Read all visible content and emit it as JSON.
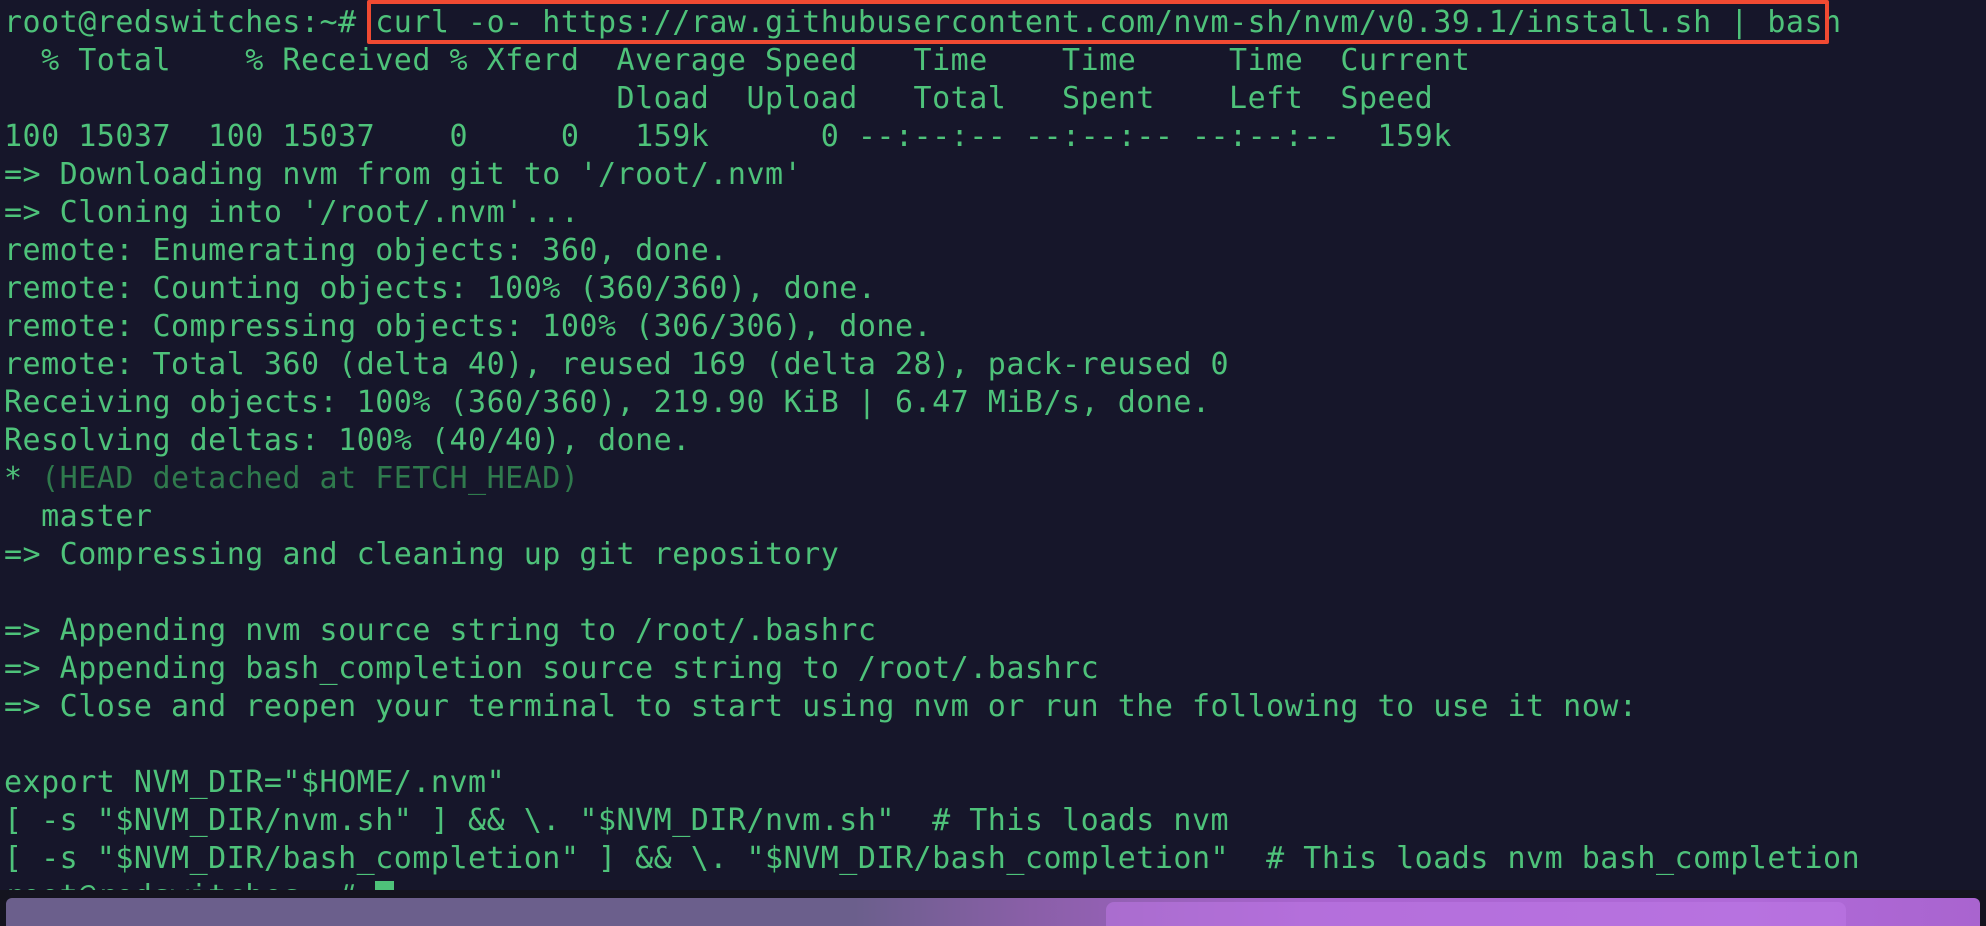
{
  "terminal": {
    "colors": {
      "background": "#16162a",
      "foreground": "#4ec27a",
      "dim_foreground": "#2f7a4d",
      "highlight_border": "#f04a32",
      "cursor": "#4ec27a",
      "taskbar_accent": "#a964cf"
    },
    "prompt": "root@redswitches:~#",
    "command": "curl -o- https://raw.githubusercontent.com/nvm-sh/nvm/v0.39.1/install.sh | bash",
    "lines": [
      {
        "id": "curl-header-1",
        "text": "  % Total    % Received % Xferd  Average Speed   Time    Time     Time  Current"
      },
      {
        "id": "curl-header-2",
        "text": "                                 Dload  Upload   Total   Spent    Left  Speed"
      },
      {
        "id": "curl-stats",
        "text": "100 15037  100 15037    0     0   159k      0 --:--:-- --:--:-- --:--:--  159k"
      },
      {
        "id": "downloading-nvm",
        "text": "=> Downloading nvm from git to '/root/.nvm'"
      },
      {
        "id": "cloning-into",
        "text": "=> Cloning into '/root/.nvm'..."
      },
      {
        "id": "remote-enumerating",
        "text": "remote: Enumerating objects: 360, done."
      },
      {
        "id": "remote-counting",
        "text": "remote: Counting objects: 100% (360/360), done."
      },
      {
        "id": "remote-compressing",
        "text": "remote: Compressing objects: 100% (306/306), done."
      },
      {
        "id": "remote-total",
        "text": "remote: Total 360 (delta 40), reused 169 (delta 28), pack-reused 0"
      },
      {
        "id": "receiving-objects",
        "text": "Receiving objects: 100% (360/360), 219.90 KiB | 6.47 MiB/s, done."
      },
      {
        "id": "resolving-deltas",
        "text": "Resolving deltas: 100% (40/40), done."
      },
      {
        "id": "head-detached",
        "text": "* (HEAD detached at FETCH_HEAD)",
        "style": "branch-detached"
      },
      {
        "id": "branch-master",
        "text": "  master"
      },
      {
        "id": "compressing-repo",
        "text": "=> Compressing and cleaning up git repository"
      },
      {
        "id": "blank-1",
        "text": ""
      },
      {
        "id": "appending-nvm",
        "text": "=> Appending nvm source string to /root/.bashrc"
      },
      {
        "id": "appending-bash-completion",
        "text": "=> Appending bash_completion source string to /root/.bashrc"
      },
      {
        "id": "close-reopen",
        "text": "=> Close and reopen your terminal to start using nvm or run the following to use it now:"
      },
      {
        "id": "blank-2",
        "text": ""
      },
      {
        "id": "export-nvm-dir",
        "text": "export NVM_DIR=\"$HOME/.nvm\""
      },
      {
        "id": "load-nvm",
        "text": "[ -s \"$NVM_DIR/nvm.sh\" ] && \\. \"$NVM_DIR/nvm.sh\"  # This loads nvm"
      },
      {
        "id": "load-bash-completion",
        "text": "[ -s \"$NVM_DIR/bash_completion\" ] && \\. \"$NVM_DIR/bash_completion\"  # This loads nvm bash_completion"
      }
    ],
    "branch_detached": {
      "marker": "* ",
      "label": "(HEAD detached at FETCH_HEAD)"
    },
    "final_prompt": "root@redswitches:~# "
  }
}
